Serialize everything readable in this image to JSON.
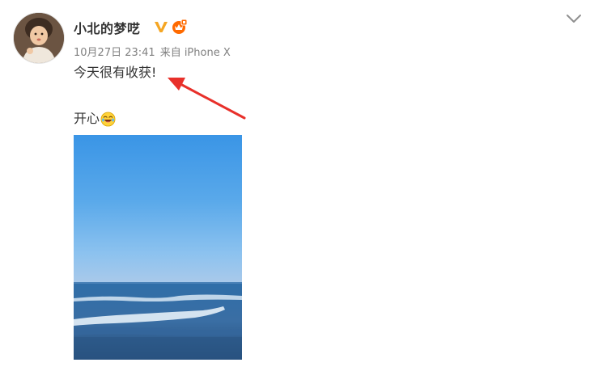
{
  "post": {
    "author": {
      "name": "小北的梦呓",
      "avatar_icon": "avatar-photo",
      "verified_badge": "V",
      "verified_color": "#f5a623",
      "member_badge_icon": "vip-crown-icon",
      "member_badge_color": "#ff6a00"
    },
    "timestamp": "10月27日 23:41",
    "source": "来自 iPhone X",
    "text_line1": "今天很有收获!",
    "text_line2": "开心",
    "emoji_icon": "laughing-emoji-icon",
    "menu_icon": "chevron-down-icon",
    "image_icon": "sea-horizon-photo",
    "annotation_icon": "red-arrow-annotation",
    "annotation_color": "#e8302a"
  }
}
